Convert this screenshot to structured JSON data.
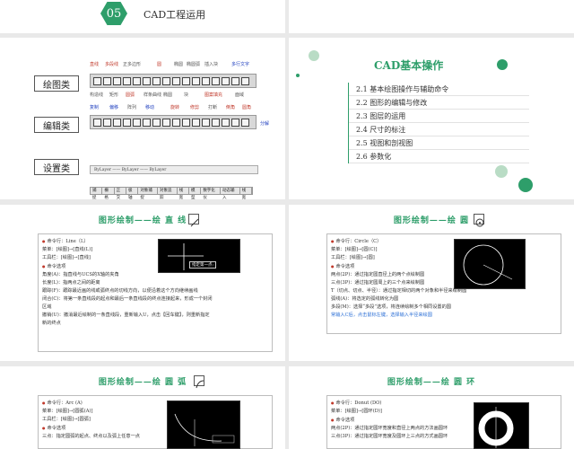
{
  "s1": {
    "badge": "05",
    "title": "CAD工程运用"
  },
  "s2": {
    "categories": [
      "绘图类",
      "编辑类",
      "设置类"
    ],
    "top_labels": [
      "直线",
      "多段线",
      "正多边形",
      "圆",
      "椭圆",
      "椭圆弧",
      "插入块",
      "多行文字"
    ],
    "bottom_labels": [
      "构造线",
      "矩形",
      "圆弧",
      "样条曲线",
      "椭圆",
      "块",
      "图案填充",
      "面域"
    ],
    "edit_labels": [
      "复制",
      "偏移",
      "阵列",
      "移动",
      "旋转",
      "修剪",
      "打断",
      "倒角",
      "圆角",
      "分解"
    ],
    "status_tabs": [
      "捕捉",
      "栅格",
      "正交",
      "极轴",
      "对象捕捉",
      "对象追踪",
      "线宽",
      "模型",
      "数字化仪",
      "动态输入",
      "线宽"
    ],
    "prop_bar": "ByLayer —— ByLayer —— ByLayer"
  },
  "s3": {
    "title": "CAD基本操作",
    "toc": [
      "2.1 基本绘图操作与辅助命令",
      "2.2 图形的编辑与修改",
      "2.3 图层的运用",
      "2.4 尺寸的标注",
      "2.5 视图和剖视图",
      "2.6 参数化"
    ]
  },
  "s4": {
    "title": "图形绘制——绘 直 线",
    "lines": [
      "命令行：Line（L）",
      "菜单：[绘图]→[直线(L)]",
      "工具栏：[绘图]→[直线]",
      "命令选项",
      "角度(A)：指直线与UCS的X轴的夹角",
      "长度(L)：指两点之间的距离",
      "跟踪(F)：跟踪最近画的线或弧终点的切线方向，以便沿着这个方向继续画线",
      "闭合(C)：将第一条直线段的起点和最后一条直线段的终点连接起来，形成一个封闭",
      "区域",
      "撤销(U)：撤消最近绘制的一条直线段，重新输入U，点击【回车键】，则重新指定",
      "新的终点"
    ],
    "prompt": "指定第一点:"
  },
  "s5": {
    "title": "图形绘制——绘 圆",
    "lines": [
      "命令行：Circle（C）",
      "菜单：[绘图]→[圆(C)]",
      "工具栏：[绘图]→[圆]",
      "命令选项",
      "两点(2P)：通过指定圆直径上的两个点绘制圆",
      "三点(3P)：通过指定圆周上的三个点来绘制圆",
      "T（切点、切点、半径）：通过指定相切的两个对象和半径来绘制圆",
      "弧线(A)：将选定的弧线转化为圆",
      "多段(M)：选择“多段”选项，将连续绘制多个相同设置的圆",
      "常输入C后，点击鼠标左键，选择输入半径来绘圆"
    ]
  },
  "s6": {
    "title": "图形绘制——绘 圆 弧",
    "lines": [
      "命令行：Arc (A)",
      "菜单：[绘图]→[圆弧(A)]",
      "工具栏：[绘图]→[圆弧]",
      "命令选项",
      "三点：指定圆弧的起点、终点以及弧上任意一点"
    ]
  },
  "s7": {
    "title": "图形绘制——绘 圆 环",
    "lines": [
      "命令行：Donut (DO)",
      "菜单：[绘图]→[圆环(D)]",
      "命令选项",
      "两点(2P)：通过指定圆环宽度和直径上两点的方法画圆环",
      "三点(3P)：通过指定圆环宽度及圆环上三点的方式画圆环"
    ]
  },
  "colors": {
    "accent": "#2e9e6a",
    "bullet": "#c0392b",
    "highlight": "#2b6fd6"
  }
}
